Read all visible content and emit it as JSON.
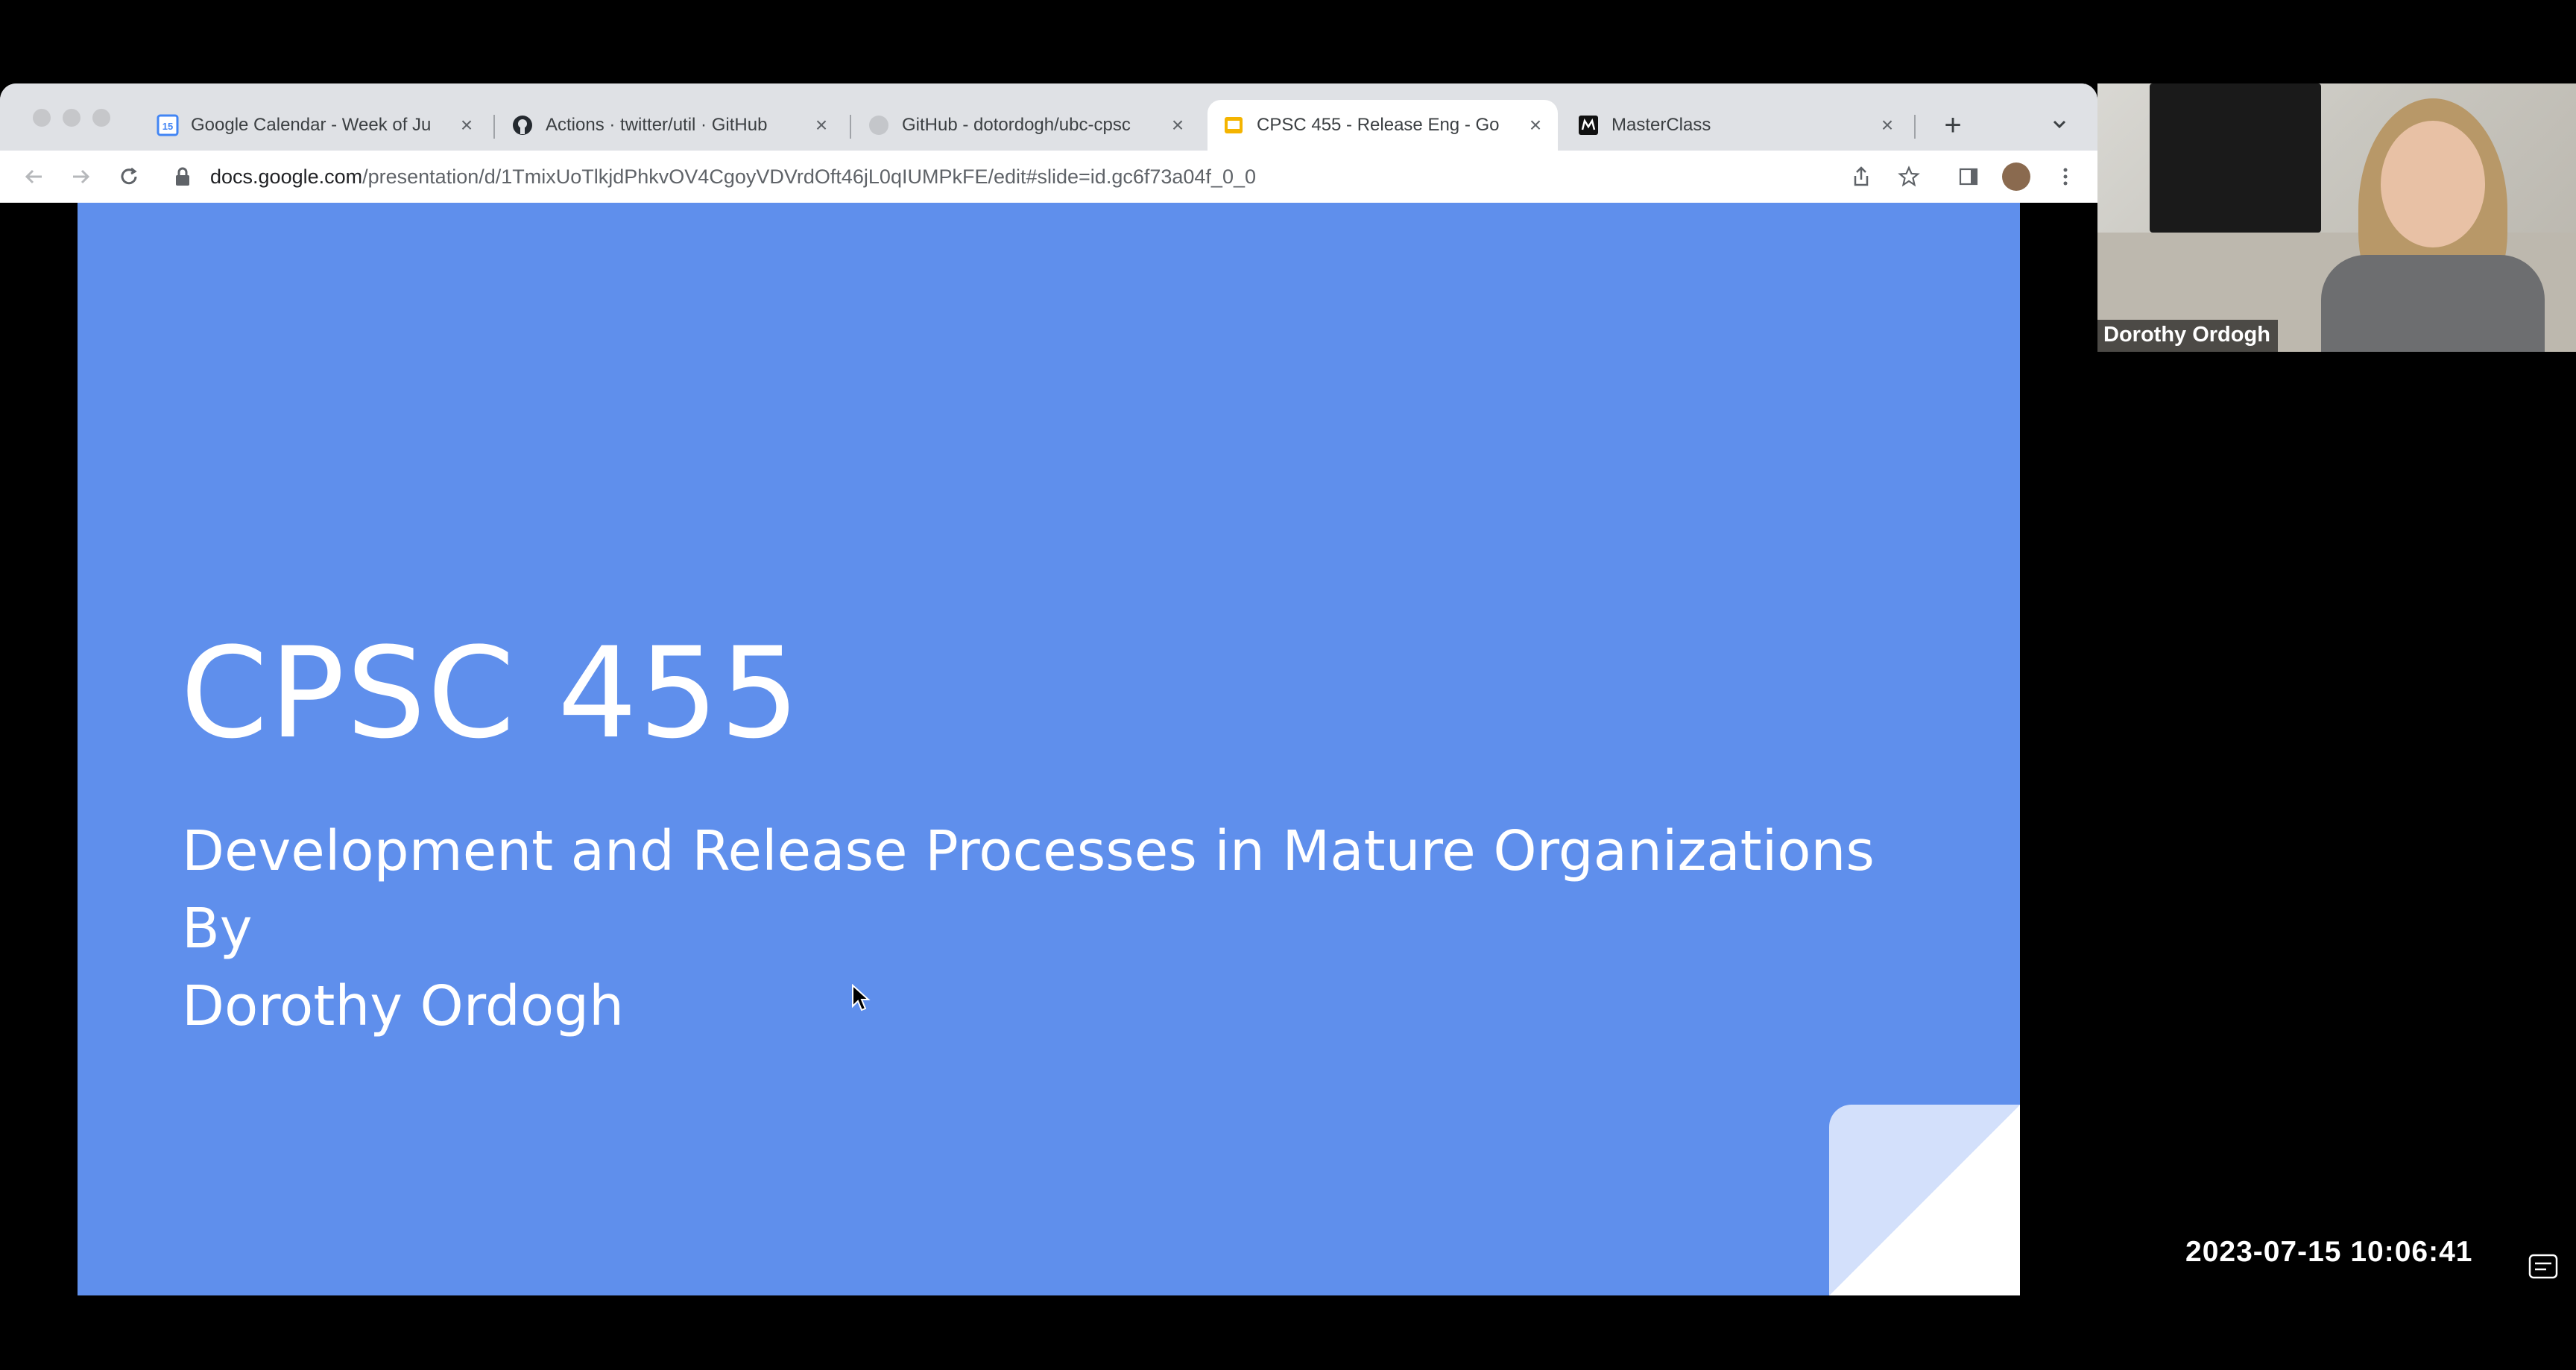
{
  "browser": {
    "tabs": [
      {
        "label": "Google Calendar - Week of Ju",
        "icon": "calendar-icon",
        "active": false
      },
      {
        "label": "Actions · twitter/util · GitHub",
        "icon": "github-icon",
        "active": false
      },
      {
        "label": "GitHub - dotordogh/ubc-cpsc",
        "icon": "github-icon",
        "active": false
      },
      {
        "label": "CPSC 455 - Release Eng - Go",
        "icon": "slides-icon",
        "active": true
      },
      {
        "label": "MasterClass",
        "icon": "masterclass-icon",
        "active": false
      }
    ],
    "calendar_day": "15",
    "url_host": "docs.google.com",
    "url_path": "/presentation/d/1TmixUoTlkjdPhkvOV4CgoyVDVrdOft46jL0qIUMPkFE/edit#slide=id.gc6f73a04f_0_0"
  },
  "slide": {
    "title": "CPSC 455",
    "subtitle_line1": "Development and Release Processes in Mature Organizations",
    "subtitle_line2": "By",
    "subtitle_line3": "Dorothy Ordogh",
    "background": "#5f8fec"
  },
  "video": {
    "participant_name": "Dorothy Ordogh"
  },
  "recording": {
    "timestamp": "2023-07-15 10:06:41"
  }
}
